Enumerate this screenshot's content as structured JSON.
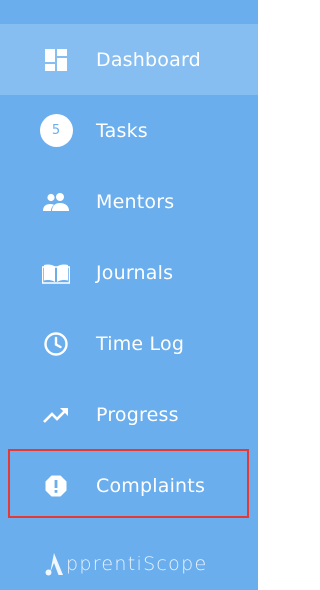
{
  "sidebar": {
    "items": [
      {
        "label": "Dashboard",
        "icon": "dashboard-icon",
        "active": true
      },
      {
        "label": "Tasks",
        "icon": "badge",
        "badge": "5"
      },
      {
        "label": "Mentors",
        "icon": "people-icon"
      },
      {
        "label": "Journals",
        "icon": "book-icon"
      },
      {
        "label": "Time Log",
        "icon": "clock-icon"
      },
      {
        "label": "Progress",
        "icon": "trending-up-icon"
      },
      {
        "label": "Complaints",
        "icon": "alert-icon",
        "highlighted": true
      }
    ]
  },
  "logo": {
    "text": "pprentiScope"
  },
  "colors": {
    "background": "#6aaeee",
    "active_background": "#86bef2",
    "highlight_border": "#e53935",
    "text": "#ffffff"
  }
}
